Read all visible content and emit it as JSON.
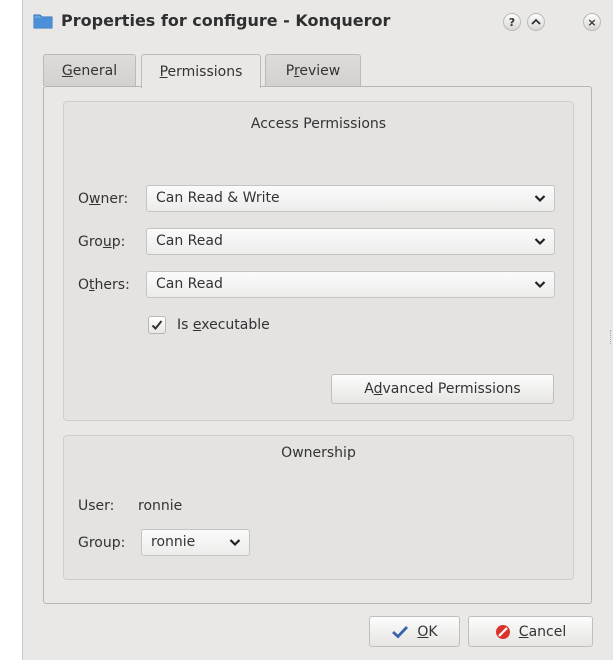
{
  "titlebar": {
    "title": "Properties for configure - Konqueror",
    "buttons": [
      "?",
      "^",
      "×"
    ]
  },
  "tabs": [
    {
      "pre": "",
      "key": "G",
      "post": "eneral"
    },
    {
      "pre": "",
      "key": "P",
      "post": "ermissions"
    },
    {
      "pre": "P",
      "key": "r",
      "post": "eview"
    }
  ],
  "access": {
    "title": "Access Permissions",
    "owner": {
      "label_pre": "O",
      "label_key": "w",
      "label_post": "ner:",
      "value": "Can Read & Write"
    },
    "group": {
      "label_pre": "Gro",
      "label_key": "u",
      "label_post": "p:",
      "value": "Can Read"
    },
    "others": {
      "label_pre": "O",
      "label_key": "t",
      "label_post": "hers:",
      "value": "Can Read"
    },
    "executable": {
      "pre": "Is ",
      "key": "e",
      "post": "xecutable",
      "checked": true
    },
    "advanced": {
      "pre": "A",
      "key": "d",
      "post": "vanced Permissions"
    }
  },
  "ownership": {
    "title": "Ownership",
    "user_label": "User:",
    "user_value": "ronnie",
    "group_label": "Group:",
    "group_value": "ronnie"
  },
  "footer": {
    "ok": {
      "key": "O",
      "post": "K"
    },
    "cancel": {
      "key": "C",
      "post": "ancel"
    }
  },
  "colors": {
    "ok_check": "#3b63a8",
    "cancel_icon": "#d9342b",
    "folder": "#4a8fd8"
  }
}
